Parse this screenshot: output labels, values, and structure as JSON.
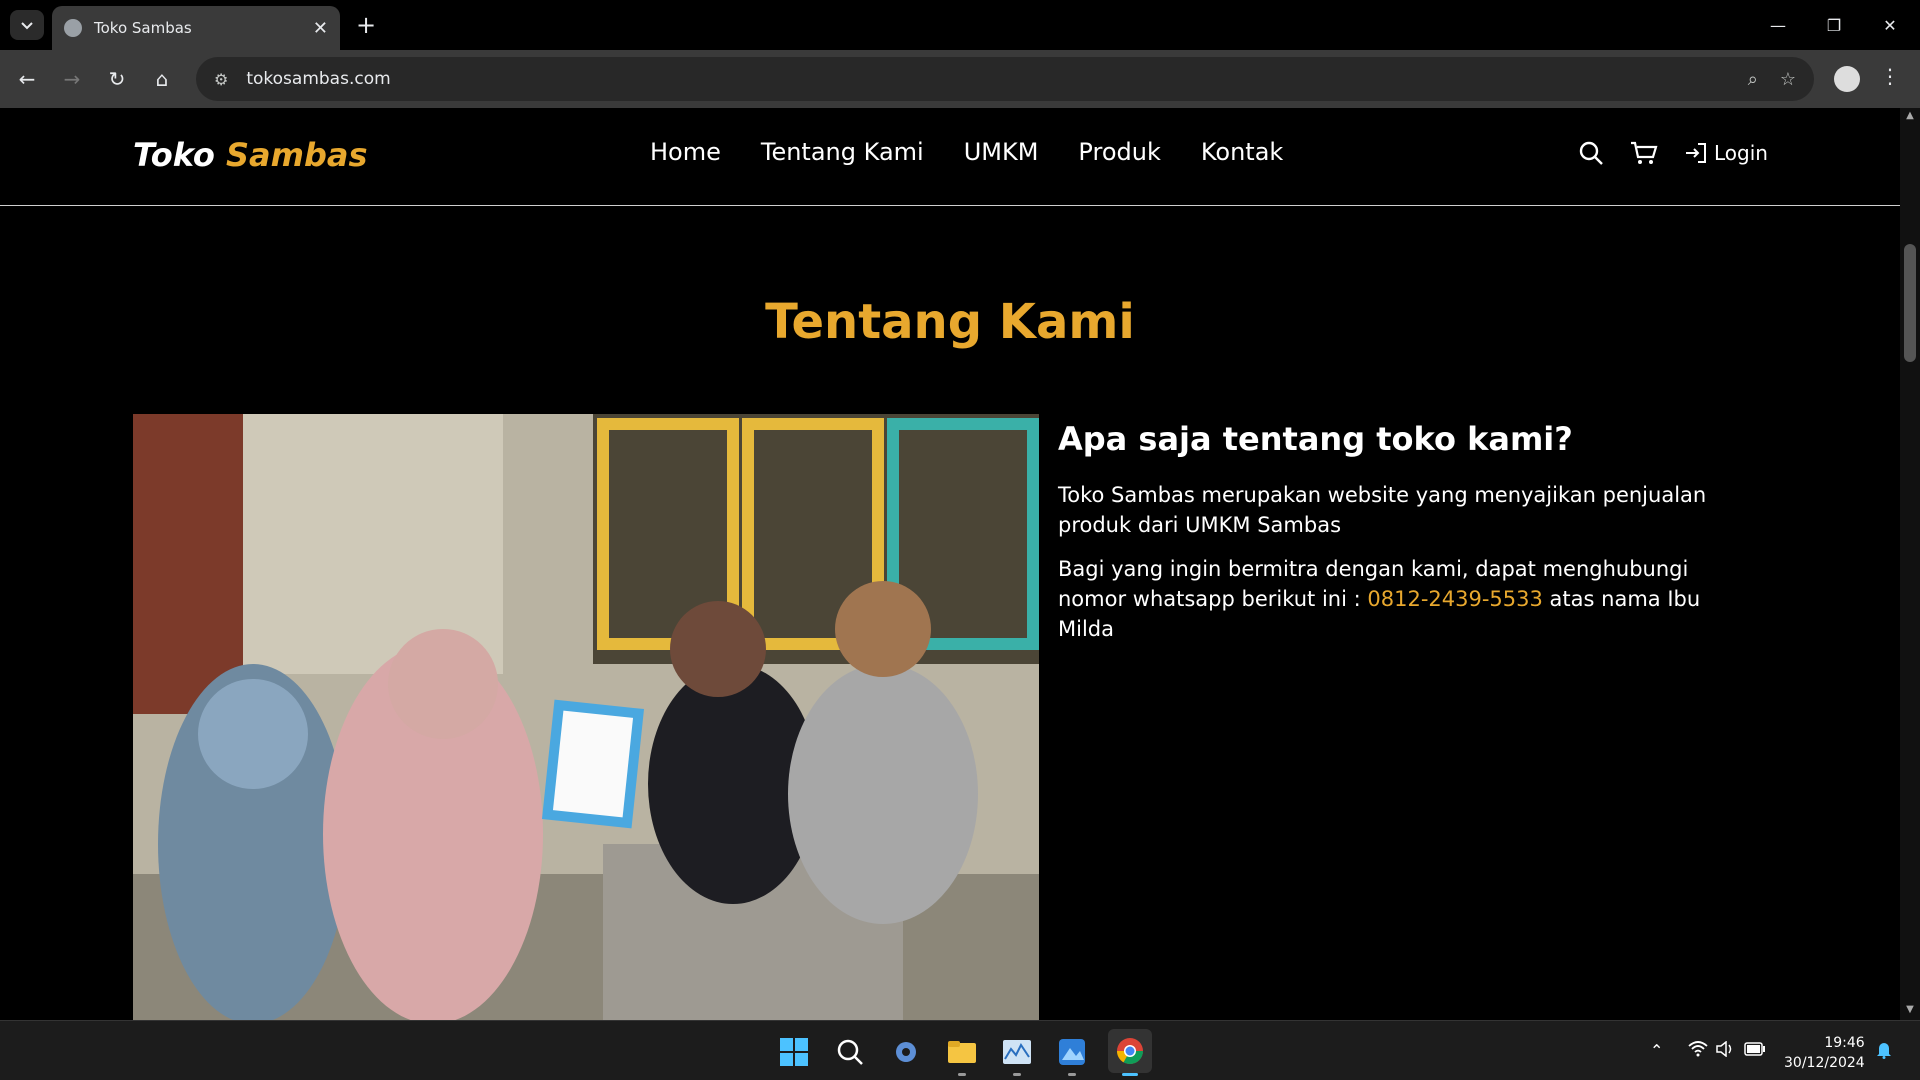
{
  "browser": {
    "tab_title": "Toko Sambas",
    "url": "tokosambas.com"
  },
  "site": {
    "brand_part1": "Toko",
    "brand_part2": "Sambas",
    "nav": [
      "Home",
      "Tentang Kami",
      "UMKM",
      "Produk",
      "Kontak"
    ],
    "login_label": "Login"
  },
  "about": {
    "section_title": "Tentang Kami",
    "heading": "Apa saja tentang toko kami?",
    "paragraph1": "Toko Sambas merupakan website yang menyajikan penjualan produk dari UMKM Sambas",
    "paragraph2_before": "Bagi yang ingin bermitra dengan kami, dapat menghubungi nomor whatsapp berikut ini : ",
    "phone": "0812-2439-5533",
    "paragraph2_after": " atas nama Ibu Milda"
  },
  "taskbar": {
    "time": "19:46",
    "date": "30/12/2024"
  },
  "colors": {
    "accent": "#e8a82e",
    "background": "#000000"
  }
}
